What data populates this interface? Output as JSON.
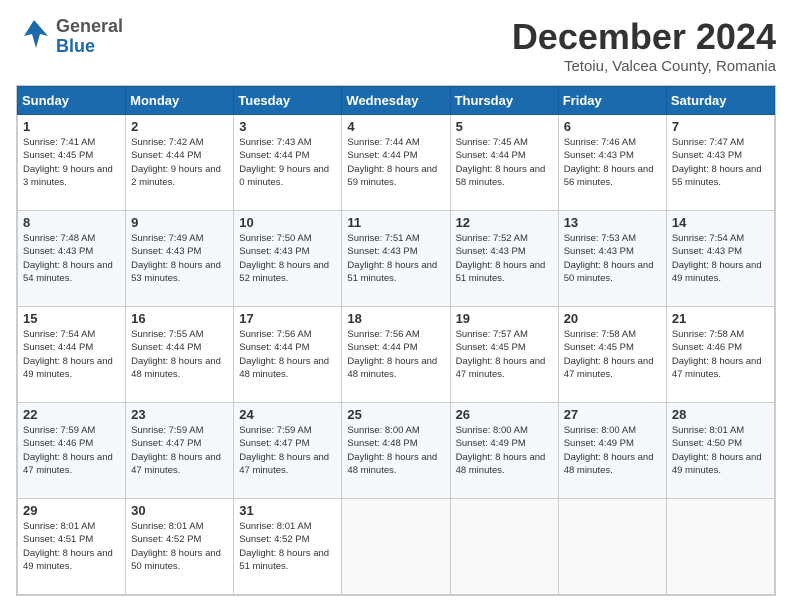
{
  "header": {
    "logo_general": "General",
    "logo_blue": "Blue",
    "month": "December 2024",
    "location": "Tetoiu, Valcea County, Romania"
  },
  "days_of_week": [
    "Sunday",
    "Monday",
    "Tuesday",
    "Wednesday",
    "Thursday",
    "Friday",
    "Saturday"
  ],
  "weeks": [
    [
      {
        "day": 1,
        "sunrise": "Sunrise: 7:41 AM",
        "sunset": "Sunset: 4:45 PM",
        "daylight": "Daylight: 9 hours and 3 minutes."
      },
      {
        "day": 2,
        "sunrise": "Sunrise: 7:42 AM",
        "sunset": "Sunset: 4:44 PM",
        "daylight": "Daylight: 9 hours and 2 minutes."
      },
      {
        "day": 3,
        "sunrise": "Sunrise: 7:43 AM",
        "sunset": "Sunset: 4:44 PM",
        "daylight": "Daylight: 9 hours and 0 minutes."
      },
      {
        "day": 4,
        "sunrise": "Sunrise: 7:44 AM",
        "sunset": "Sunset: 4:44 PM",
        "daylight": "Daylight: 8 hours and 59 minutes."
      },
      {
        "day": 5,
        "sunrise": "Sunrise: 7:45 AM",
        "sunset": "Sunset: 4:44 PM",
        "daylight": "Daylight: 8 hours and 58 minutes."
      },
      {
        "day": 6,
        "sunrise": "Sunrise: 7:46 AM",
        "sunset": "Sunset: 4:43 PM",
        "daylight": "Daylight: 8 hours and 56 minutes."
      },
      {
        "day": 7,
        "sunrise": "Sunrise: 7:47 AM",
        "sunset": "Sunset: 4:43 PM",
        "daylight": "Daylight: 8 hours and 55 minutes."
      }
    ],
    [
      {
        "day": 8,
        "sunrise": "Sunrise: 7:48 AM",
        "sunset": "Sunset: 4:43 PM",
        "daylight": "Daylight: 8 hours and 54 minutes."
      },
      {
        "day": 9,
        "sunrise": "Sunrise: 7:49 AM",
        "sunset": "Sunset: 4:43 PM",
        "daylight": "Daylight: 8 hours and 53 minutes."
      },
      {
        "day": 10,
        "sunrise": "Sunrise: 7:50 AM",
        "sunset": "Sunset: 4:43 PM",
        "daylight": "Daylight: 8 hours and 52 minutes."
      },
      {
        "day": 11,
        "sunrise": "Sunrise: 7:51 AM",
        "sunset": "Sunset: 4:43 PM",
        "daylight": "Daylight: 8 hours and 51 minutes."
      },
      {
        "day": 12,
        "sunrise": "Sunrise: 7:52 AM",
        "sunset": "Sunset: 4:43 PM",
        "daylight": "Daylight: 8 hours and 51 minutes."
      },
      {
        "day": 13,
        "sunrise": "Sunrise: 7:53 AM",
        "sunset": "Sunset: 4:43 PM",
        "daylight": "Daylight: 8 hours and 50 minutes."
      },
      {
        "day": 14,
        "sunrise": "Sunrise: 7:54 AM",
        "sunset": "Sunset: 4:43 PM",
        "daylight": "Daylight: 8 hours and 49 minutes."
      }
    ],
    [
      {
        "day": 15,
        "sunrise": "Sunrise: 7:54 AM",
        "sunset": "Sunset: 4:44 PM",
        "daylight": "Daylight: 8 hours and 49 minutes."
      },
      {
        "day": 16,
        "sunrise": "Sunrise: 7:55 AM",
        "sunset": "Sunset: 4:44 PM",
        "daylight": "Daylight: 8 hours and 48 minutes."
      },
      {
        "day": 17,
        "sunrise": "Sunrise: 7:56 AM",
        "sunset": "Sunset: 4:44 PM",
        "daylight": "Daylight: 8 hours and 48 minutes."
      },
      {
        "day": 18,
        "sunrise": "Sunrise: 7:56 AM",
        "sunset": "Sunset: 4:44 PM",
        "daylight": "Daylight: 8 hours and 48 minutes."
      },
      {
        "day": 19,
        "sunrise": "Sunrise: 7:57 AM",
        "sunset": "Sunset: 4:45 PM",
        "daylight": "Daylight: 8 hours and 47 minutes."
      },
      {
        "day": 20,
        "sunrise": "Sunrise: 7:58 AM",
        "sunset": "Sunset: 4:45 PM",
        "daylight": "Daylight: 8 hours and 47 minutes."
      },
      {
        "day": 21,
        "sunrise": "Sunrise: 7:58 AM",
        "sunset": "Sunset: 4:46 PM",
        "daylight": "Daylight: 8 hours and 47 minutes."
      }
    ],
    [
      {
        "day": 22,
        "sunrise": "Sunrise: 7:59 AM",
        "sunset": "Sunset: 4:46 PM",
        "daylight": "Daylight: 8 hours and 47 minutes."
      },
      {
        "day": 23,
        "sunrise": "Sunrise: 7:59 AM",
        "sunset": "Sunset: 4:47 PM",
        "daylight": "Daylight: 8 hours and 47 minutes."
      },
      {
        "day": 24,
        "sunrise": "Sunrise: 7:59 AM",
        "sunset": "Sunset: 4:47 PM",
        "daylight": "Daylight: 8 hours and 47 minutes."
      },
      {
        "day": 25,
        "sunrise": "Sunrise: 8:00 AM",
        "sunset": "Sunset: 4:48 PM",
        "daylight": "Daylight: 8 hours and 48 minutes."
      },
      {
        "day": 26,
        "sunrise": "Sunrise: 8:00 AM",
        "sunset": "Sunset: 4:49 PM",
        "daylight": "Daylight: 8 hours and 48 minutes."
      },
      {
        "day": 27,
        "sunrise": "Sunrise: 8:00 AM",
        "sunset": "Sunset: 4:49 PM",
        "daylight": "Daylight: 8 hours and 48 minutes."
      },
      {
        "day": 28,
        "sunrise": "Sunrise: 8:01 AM",
        "sunset": "Sunset: 4:50 PM",
        "daylight": "Daylight: 8 hours and 49 minutes."
      }
    ],
    [
      {
        "day": 29,
        "sunrise": "Sunrise: 8:01 AM",
        "sunset": "Sunset: 4:51 PM",
        "daylight": "Daylight: 8 hours and 49 minutes."
      },
      {
        "day": 30,
        "sunrise": "Sunrise: 8:01 AM",
        "sunset": "Sunset: 4:52 PM",
        "daylight": "Daylight: 8 hours and 50 minutes."
      },
      {
        "day": 31,
        "sunrise": "Sunrise: 8:01 AM",
        "sunset": "Sunset: 4:52 PM",
        "daylight": "Daylight: 8 hours and 51 minutes."
      },
      null,
      null,
      null,
      null
    ]
  ]
}
